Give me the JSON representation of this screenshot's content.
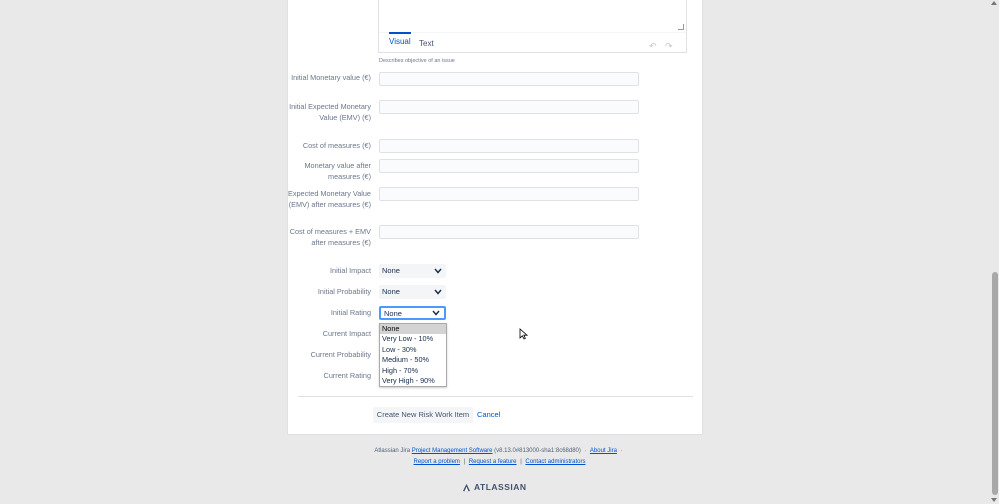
{
  "editor": {
    "tab_visual": "Visual",
    "tab_text": "Text",
    "undo_icon": "↶",
    "redo_icon": "↷",
    "description": "Describes objective of an issue"
  },
  "fields": {
    "initial_monetary_value": {
      "label": "Initial Monetary value (€)",
      "value": ""
    },
    "initial_emv": {
      "label": "Initial Expected Monetary Value (EMV) (€)",
      "value": ""
    },
    "cost_of_measures": {
      "label": "Cost of measures (€)",
      "value": ""
    },
    "monetary_after": {
      "label": "Monetary value after measures (€)",
      "value": ""
    },
    "emv_after": {
      "label": "Expected Monetary Value (EMV) after measures (€)",
      "value": ""
    },
    "cost_plus_emv": {
      "label": "Cost of measures + EMV after measures (€)",
      "value": ""
    }
  },
  "selects": {
    "initial_impact": {
      "label": "Initial Impact",
      "value": "None"
    },
    "initial_probability": {
      "label": "Initial Probability",
      "value": "None"
    },
    "initial_rating": {
      "label": "Initial Rating",
      "value": "None"
    },
    "current_impact": {
      "label": "Current Impact"
    },
    "current_probability": {
      "label": "Current Probability"
    },
    "current_rating": {
      "label": "Current Rating"
    }
  },
  "dropdown": {
    "options": [
      "None",
      "Very Low - 10%",
      "Low - 30%",
      "Medium - 50%",
      "High - 70%",
      "Very High - 90%"
    ],
    "selected_index": 0
  },
  "actions": {
    "create_label": "Create New Risk Work Item",
    "cancel_label": "Cancel"
  },
  "footer": {
    "prefix": "Atlassian Jira",
    "pm_link": "Project Management Software",
    "version": "(v8.13.0#813000-sha1:8c68d80)",
    "about": "About Jira",
    "report": "Report a problem",
    "request": "Request a feature",
    "contact": "Contact administrators",
    "brand": "ATLASSIAN"
  },
  "colors": {
    "accent": "#0052cc",
    "focus": "#4c9aff"
  }
}
